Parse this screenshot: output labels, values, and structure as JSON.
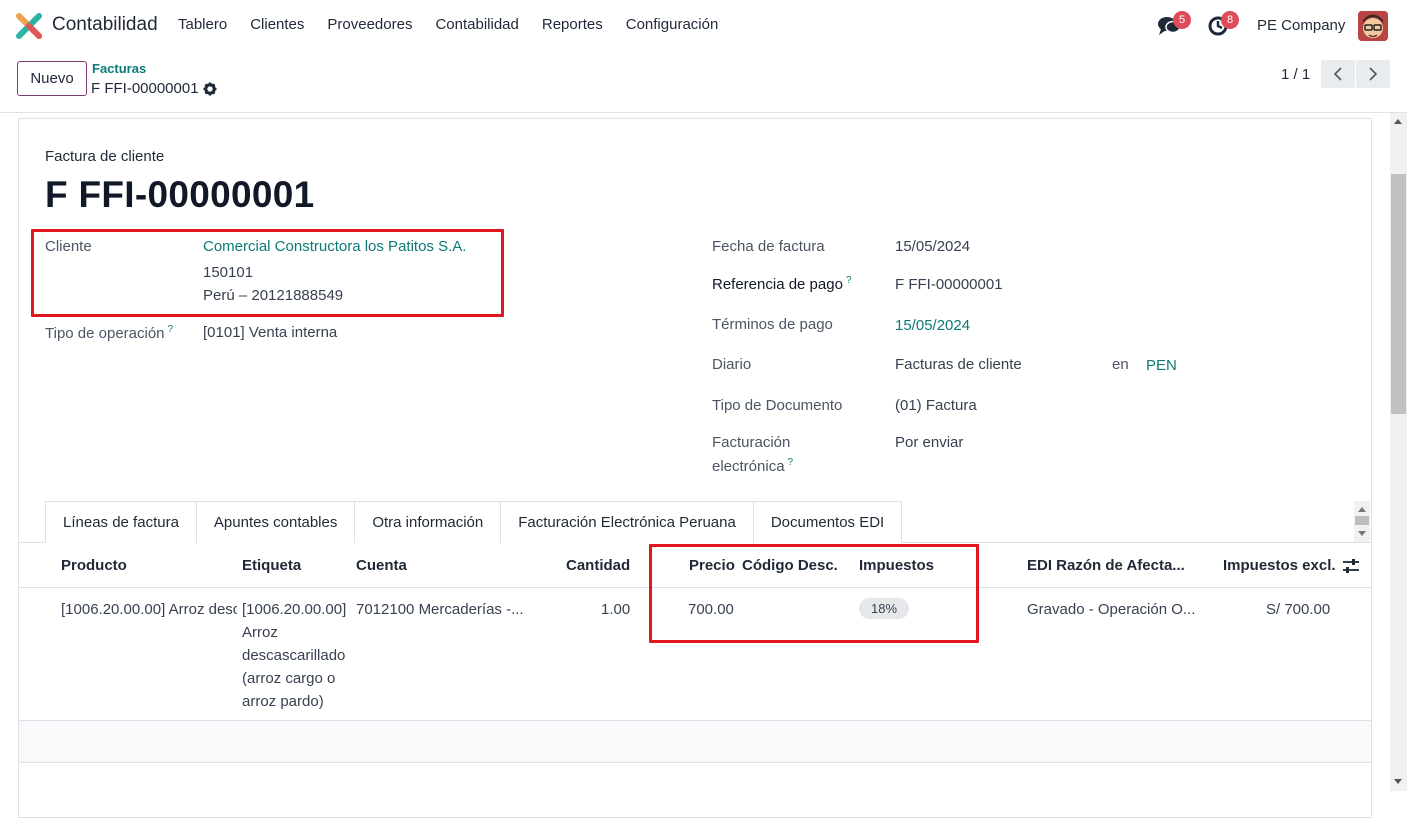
{
  "app": {
    "name": "Contabilidad",
    "menu": [
      "Tablero",
      "Clientes",
      "Proveedores",
      "Contabilidad",
      "Reportes",
      "Configuración"
    ],
    "messages_count": "5",
    "activities_count": "8",
    "company": "PE Company"
  },
  "control": {
    "new_label": "Nuevo",
    "breadcrumb": "Facturas",
    "record": "F FFI-00000001",
    "pager": "1 / 1"
  },
  "form": {
    "doc_type": "Factura de cliente",
    "title": "F FFI-00000001",
    "left": {
      "cliente_label": "Cliente",
      "cliente_name": "Comercial Constructora los Patitos S.A.",
      "cliente_addr1": "150101",
      "cliente_addr2": "Perú – 20121888549",
      "tipo_op_label": "Tipo de operación",
      "tipo_op_value": "[0101] Venta interna"
    },
    "right": {
      "fecha_label": "Fecha de factura",
      "fecha_value": "15/05/2024",
      "ref_label": "Referencia de pago",
      "ref_value": "F FFI-00000001",
      "terminos_label": "Términos de pago",
      "terminos_value": "15/05/2024",
      "diario_label": "Diario",
      "diario_value": "Facturas de cliente",
      "en_label": "en",
      "currency": "PEN",
      "tipo_doc_label": "Tipo de Documento",
      "tipo_doc_value": "(01) Factura",
      "fe_label_1": "Facturación",
      "fe_label_2": "electrónica",
      "fe_value": "Por enviar"
    },
    "help_mark": "?"
  },
  "tabs": [
    "Líneas de factura",
    "Apuntes contables",
    "Otra información",
    "Facturación Electrónica Peruana",
    "Documentos EDI"
  ],
  "table": {
    "headers": {
      "producto": "Producto",
      "etiqueta": "Etiqueta",
      "cuenta": "Cuenta",
      "cantidad": "Cantidad",
      "precio": "Precio",
      "codigo": "Código Desc.",
      "impuestos": "Impuestos",
      "edi": "EDI Razón de Afecta...",
      "excl": "Impuestos excl."
    },
    "rows": [
      {
        "producto": "[1006.20.00.00] Arroz desc",
        "etiqueta_lines": [
          "[1006.20.00.00]",
          "Arroz",
          "descascarillado",
          "(arroz cargo o",
          "arroz pardo)"
        ],
        "cuenta": "7012100 Mercaderías -...",
        "cantidad": "1.00",
        "precio": "700.00",
        "impuesto_tag": "18%",
        "edi": "Gravado - Operación O...",
        "excl": "S/ 700.00"
      }
    ]
  },
  "colors": {
    "accent_link": "#0b7a75",
    "primary_border": "#7c3d6e",
    "highlight_box": "#e0171f",
    "badge": "#e04b5a"
  }
}
